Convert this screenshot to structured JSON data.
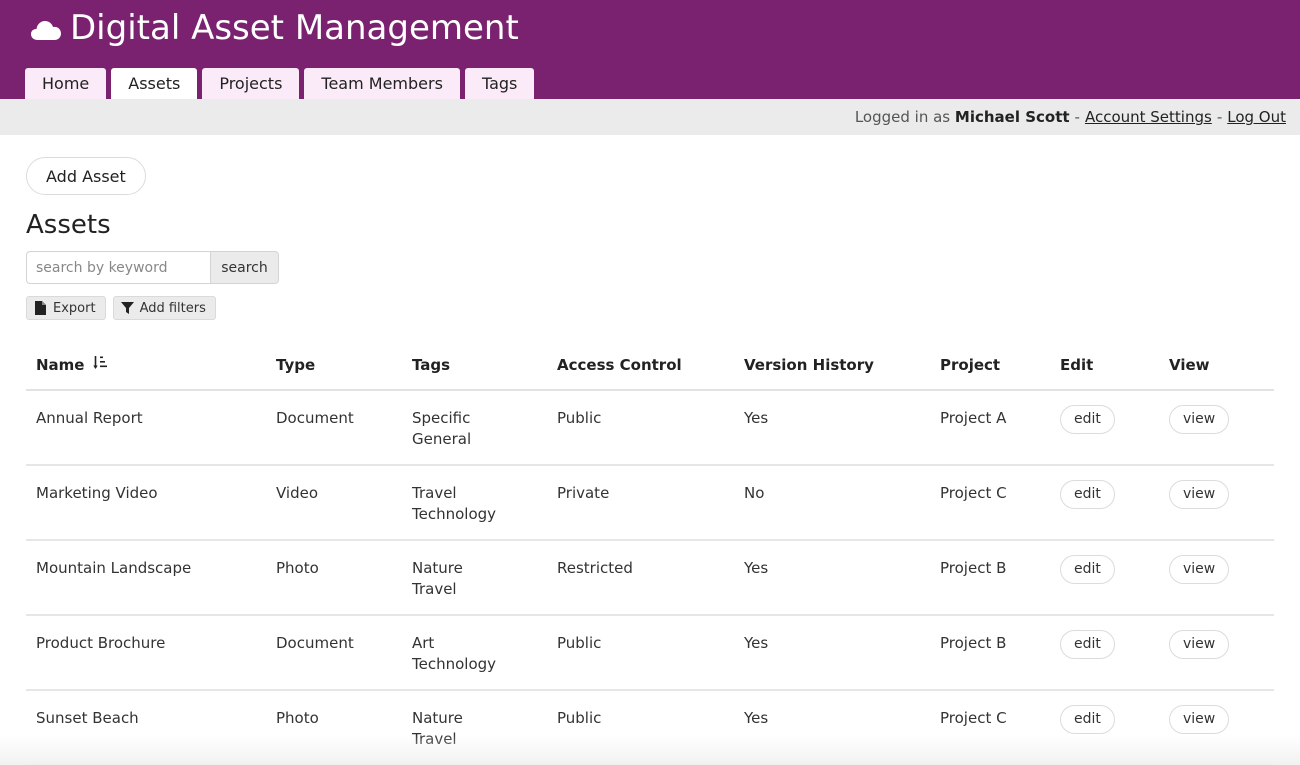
{
  "app": {
    "title": "Digital Asset Management",
    "brand_color": "#7a226f",
    "logo_icon": "cloud-icon"
  },
  "nav": {
    "tabs": [
      {
        "label": "Home",
        "active": false
      },
      {
        "label": "Assets",
        "active": true
      },
      {
        "label": "Projects",
        "active": false
      },
      {
        "label": "Team Members",
        "active": false
      },
      {
        "label": "Tags",
        "active": false
      }
    ]
  },
  "userbar": {
    "prefix": "Logged in as",
    "username": "Michael Scott",
    "separator": "-",
    "account_settings": "Account Settings",
    "logout": "Log Out"
  },
  "main": {
    "add_button": "Add Asset",
    "title": "Assets",
    "search": {
      "placeholder": "search by keyword",
      "value": "",
      "button": "search"
    },
    "tools": {
      "export": "Export",
      "export_icon": "file-icon",
      "filters": "Add filters",
      "filters_icon": "filter-icon"
    }
  },
  "table": {
    "columns": [
      "Name",
      "Type",
      "Tags",
      "Access Control",
      "Version History",
      "Project",
      "Edit",
      "View"
    ],
    "sort_icon": "sort-ascending-icon",
    "edit_label": "edit",
    "view_label": "view",
    "rows": [
      {
        "name": "Annual Report",
        "type": "Document",
        "tags": [
          "Specific",
          "General"
        ],
        "access": "Public",
        "version": "Yes",
        "project": "Project A"
      },
      {
        "name": "Marketing Video",
        "type": "Video",
        "tags": [
          "Travel",
          "Technology"
        ],
        "access": "Private",
        "version": "No",
        "project": "Project C"
      },
      {
        "name": "Mountain Landscape",
        "type": "Photo",
        "tags": [
          "Nature",
          "Travel"
        ],
        "access": "Restricted",
        "version": "Yes",
        "project": "Project B"
      },
      {
        "name": "Product Brochure",
        "type": "Document",
        "tags": [
          "Art",
          "Technology"
        ],
        "access": "Public",
        "version": "Yes",
        "project": "Project B"
      },
      {
        "name": "Sunset Beach",
        "type": "Photo",
        "tags": [
          "Nature",
          "Travel"
        ],
        "access": "Public",
        "version": "Yes",
        "project": "Project C"
      }
    ]
  }
}
